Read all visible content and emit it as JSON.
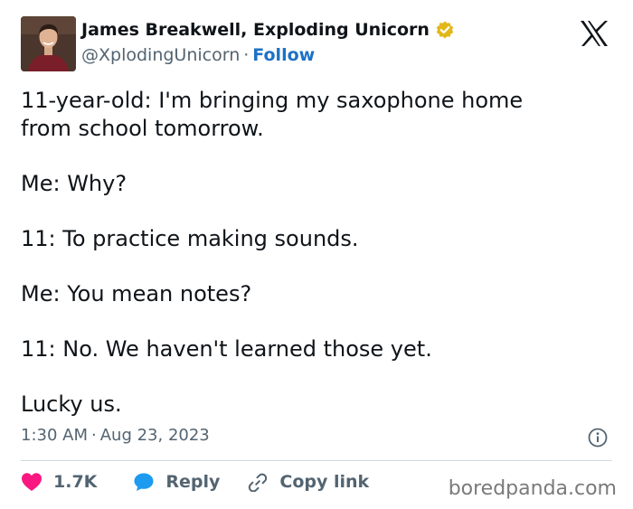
{
  "author": {
    "display_name": "James Breakwell, Exploding Unicorn",
    "handle": "@XplodingUnicorn",
    "separator": "·",
    "follow_label": "Follow",
    "avatar_icon": "profile-photo",
    "verified_icon": "gold-verified-badge"
  },
  "tweet": {
    "paragraphs": [
      "11-year-old: I'm bringing my saxophone home\nfrom school tomorrow.",
      "Me: Why?",
      "11: To practice making sounds.",
      "Me: You mean notes?",
      "11: No. We haven't learned those yet.",
      "Lucky us."
    ],
    "time": "1:30 AM",
    "separator": "·",
    "date": "Aug 23, 2023"
  },
  "actions": {
    "like_count": "1.7K",
    "reply_label": "Reply",
    "copy_link_label": "Copy link"
  },
  "watermark": "boredpanda.com",
  "colors": {
    "like": "#f91880",
    "reply": "#1d9bf0",
    "follow": "#1d72c6",
    "verified": "#e2b719",
    "muted": "#536471"
  }
}
